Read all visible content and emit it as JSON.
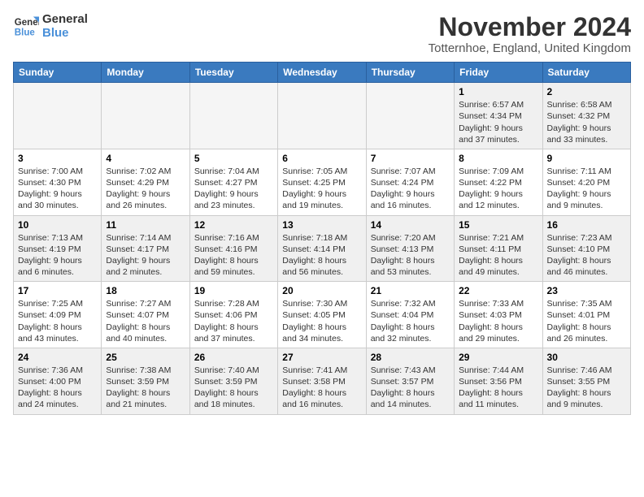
{
  "logo": {
    "line1": "General",
    "line2": "Blue"
  },
  "title": "November 2024",
  "location": "Totternhoe, England, United Kingdom",
  "days_of_week": [
    "Sunday",
    "Monday",
    "Tuesday",
    "Wednesday",
    "Thursday",
    "Friday",
    "Saturday"
  ],
  "weeks": [
    [
      {
        "day": "",
        "info": "",
        "empty": true
      },
      {
        "day": "",
        "info": "",
        "empty": true
      },
      {
        "day": "",
        "info": "",
        "empty": true
      },
      {
        "day": "",
        "info": "",
        "empty": true
      },
      {
        "day": "",
        "info": "",
        "empty": true
      },
      {
        "day": "1",
        "info": "Sunrise: 6:57 AM\nSunset: 4:34 PM\nDaylight: 9 hours and 37 minutes."
      },
      {
        "day": "2",
        "info": "Sunrise: 6:58 AM\nSunset: 4:32 PM\nDaylight: 9 hours and 33 minutes."
      }
    ],
    [
      {
        "day": "3",
        "info": "Sunrise: 7:00 AM\nSunset: 4:30 PM\nDaylight: 9 hours and 30 minutes."
      },
      {
        "day": "4",
        "info": "Sunrise: 7:02 AM\nSunset: 4:29 PM\nDaylight: 9 hours and 26 minutes."
      },
      {
        "day": "5",
        "info": "Sunrise: 7:04 AM\nSunset: 4:27 PM\nDaylight: 9 hours and 23 minutes."
      },
      {
        "day": "6",
        "info": "Sunrise: 7:05 AM\nSunset: 4:25 PM\nDaylight: 9 hours and 19 minutes."
      },
      {
        "day": "7",
        "info": "Sunrise: 7:07 AM\nSunset: 4:24 PM\nDaylight: 9 hours and 16 minutes."
      },
      {
        "day": "8",
        "info": "Sunrise: 7:09 AM\nSunset: 4:22 PM\nDaylight: 9 hours and 12 minutes."
      },
      {
        "day": "9",
        "info": "Sunrise: 7:11 AM\nSunset: 4:20 PM\nDaylight: 9 hours and 9 minutes."
      }
    ],
    [
      {
        "day": "10",
        "info": "Sunrise: 7:13 AM\nSunset: 4:19 PM\nDaylight: 9 hours and 6 minutes."
      },
      {
        "day": "11",
        "info": "Sunrise: 7:14 AM\nSunset: 4:17 PM\nDaylight: 9 hours and 2 minutes."
      },
      {
        "day": "12",
        "info": "Sunrise: 7:16 AM\nSunset: 4:16 PM\nDaylight: 8 hours and 59 minutes."
      },
      {
        "day": "13",
        "info": "Sunrise: 7:18 AM\nSunset: 4:14 PM\nDaylight: 8 hours and 56 minutes."
      },
      {
        "day": "14",
        "info": "Sunrise: 7:20 AM\nSunset: 4:13 PM\nDaylight: 8 hours and 53 minutes."
      },
      {
        "day": "15",
        "info": "Sunrise: 7:21 AM\nSunset: 4:11 PM\nDaylight: 8 hours and 49 minutes."
      },
      {
        "day": "16",
        "info": "Sunrise: 7:23 AM\nSunset: 4:10 PM\nDaylight: 8 hours and 46 minutes."
      }
    ],
    [
      {
        "day": "17",
        "info": "Sunrise: 7:25 AM\nSunset: 4:09 PM\nDaylight: 8 hours and 43 minutes."
      },
      {
        "day": "18",
        "info": "Sunrise: 7:27 AM\nSunset: 4:07 PM\nDaylight: 8 hours and 40 minutes."
      },
      {
        "day": "19",
        "info": "Sunrise: 7:28 AM\nSunset: 4:06 PM\nDaylight: 8 hours and 37 minutes."
      },
      {
        "day": "20",
        "info": "Sunrise: 7:30 AM\nSunset: 4:05 PM\nDaylight: 8 hours and 34 minutes."
      },
      {
        "day": "21",
        "info": "Sunrise: 7:32 AM\nSunset: 4:04 PM\nDaylight: 8 hours and 32 minutes."
      },
      {
        "day": "22",
        "info": "Sunrise: 7:33 AM\nSunset: 4:03 PM\nDaylight: 8 hours and 29 minutes."
      },
      {
        "day": "23",
        "info": "Sunrise: 7:35 AM\nSunset: 4:01 PM\nDaylight: 8 hours and 26 minutes."
      }
    ],
    [
      {
        "day": "24",
        "info": "Sunrise: 7:36 AM\nSunset: 4:00 PM\nDaylight: 8 hours and 24 minutes."
      },
      {
        "day": "25",
        "info": "Sunrise: 7:38 AM\nSunset: 3:59 PM\nDaylight: 8 hours and 21 minutes."
      },
      {
        "day": "26",
        "info": "Sunrise: 7:40 AM\nSunset: 3:59 PM\nDaylight: 8 hours and 18 minutes."
      },
      {
        "day": "27",
        "info": "Sunrise: 7:41 AM\nSunset: 3:58 PM\nDaylight: 8 hours and 16 minutes."
      },
      {
        "day": "28",
        "info": "Sunrise: 7:43 AM\nSunset: 3:57 PM\nDaylight: 8 hours and 14 minutes."
      },
      {
        "day": "29",
        "info": "Sunrise: 7:44 AM\nSunset: 3:56 PM\nDaylight: 8 hours and 11 minutes."
      },
      {
        "day": "30",
        "info": "Sunrise: 7:46 AM\nSunset: 3:55 PM\nDaylight: 8 hours and 9 minutes."
      }
    ]
  ]
}
